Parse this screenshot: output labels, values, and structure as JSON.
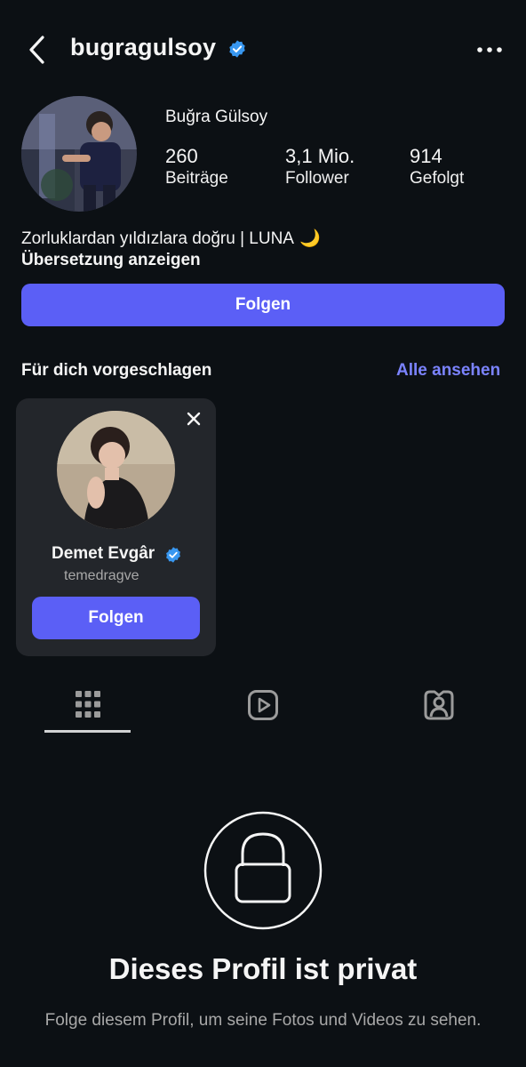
{
  "header": {
    "username": "bugragulsoy"
  },
  "profile": {
    "full_name": "Buğra Gülsoy",
    "stats": [
      {
        "value": "260",
        "label": "Beiträge"
      },
      {
        "value": "3,1 Mio.",
        "label": "Follower"
      },
      {
        "value": "914",
        "label": "Gefolgt"
      }
    ],
    "bio": "Zorluklardan yıldızlara doğru | LUNA",
    "bio_emoji": "🌙",
    "translate_label": "Übersetzung anzeigen",
    "follow_label": "Folgen"
  },
  "suggestions": {
    "title": "Für dich vorgeschlagen",
    "see_all": "Alle ansehen",
    "card": {
      "name": "Demet Evgâr",
      "handle": "temedragve",
      "follow_label": "Folgen"
    }
  },
  "tabs": [
    {
      "icon": "grid-icon",
      "active": true
    },
    {
      "icon": "reels-icon",
      "active": false
    },
    {
      "icon": "tagged-icon",
      "active": false
    }
  ],
  "private": {
    "title": "Dieses Profil ist privat",
    "text": "Folge diesem Profil, um seine Fotos und Videos zu sehen."
  },
  "colors": {
    "background": "#0c1014",
    "accent": "#5b5ff6",
    "link": "#7b83ff",
    "verified": "#3897f0"
  }
}
